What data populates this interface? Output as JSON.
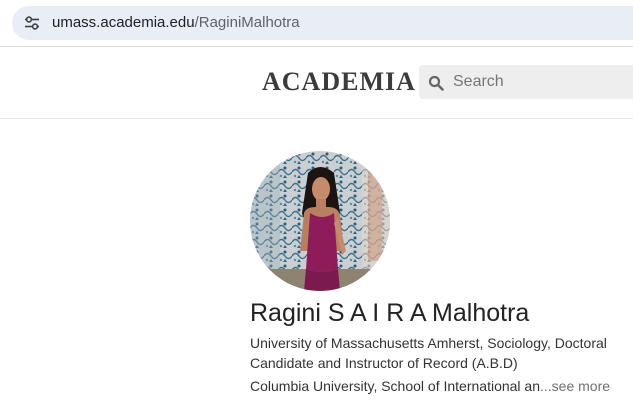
{
  "browser": {
    "url_host": "umass.academia.edu",
    "url_path": "/RaginiMalhotra"
  },
  "header": {
    "logo": "ACADEMIA",
    "search_placeholder": "Search"
  },
  "profile": {
    "name": "Ragini S A I R A Malhotra",
    "affiliation_primary": "University of Massachusetts Amherst, Sociology, Doctoral Candidate and Instructor of Record (A.B.D)",
    "affiliation_secondary": "Columbia University, School of International an",
    "see_more": "...see more"
  },
  "colors": {
    "omnibox_bg": "#e9eef6",
    "search_bg": "#eeeeee",
    "logo": "#3b3b3b",
    "see_more": "#707070"
  }
}
